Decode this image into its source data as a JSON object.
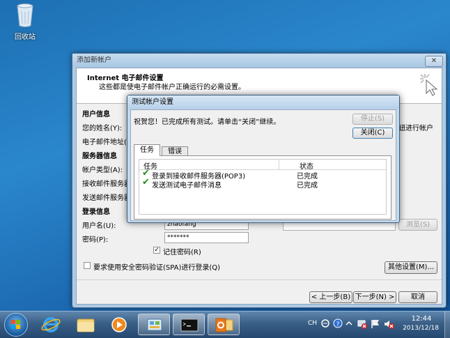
{
  "desktop": {
    "recycle_bin_label": "回收站"
  },
  "wizard": {
    "title": "添加新帐户",
    "close_label": "✕",
    "header_title": "Internet 电子邮件设置",
    "header_subtitle": "这些都是使电子邮件帐户正确运行的必需设置。",
    "user_info_heading": "用户信息",
    "name_label": "您的姓名(Y):",
    "email_label": "电子邮件地址(E",
    "server_info_heading": "服务器信息",
    "account_type_label": "帐户类型(A):",
    "incoming_label": "接收邮件服务器",
    "outgoing_label": "发送邮件服务器",
    "login_info_heading": "登录信息",
    "username_label": "用户名(U):",
    "username_value": "zhaofang",
    "password_label": "密码(P):",
    "password_value": "*******",
    "remember_password_label": "记住密码(R)",
    "remember_password_checked": "✓",
    "spa_label": "要求使用安全密码验证(SPA)进行登录(Q)",
    "right_hint": "钮进行帐户",
    "browse_button": "浏览(S)",
    "more_settings_button": "其他设置(M)...",
    "back_button": "< 上一步(B)",
    "next_button": "下一步(N) >",
    "cancel_button": "取消"
  },
  "test_dialog": {
    "title": "测试帐户设置",
    "message": "祝贺您！已完成所有测试。请单击“关闭”继续。",
    "stop_button": "停止(S)",
    "close_button": "关闭(C)",
    "tabs": [
      "任务",
      "错误"
    ],
    "columns": [
      "任务",
      "状态"
    ],
    "rows": [
      {
        "task": "登录到接收邮件服务器(POP3)",
        "status": "已完成"
      },
      {
        "task": "发送测试电子邮件消息",
        "status": "已完成"
      }
    ]
  },
  "taskbar": {
    "language": "CH",
    "time": "12:44",
    "date": "2013/12/18",
    "accent_color": "#3a5f86"
  }
}
